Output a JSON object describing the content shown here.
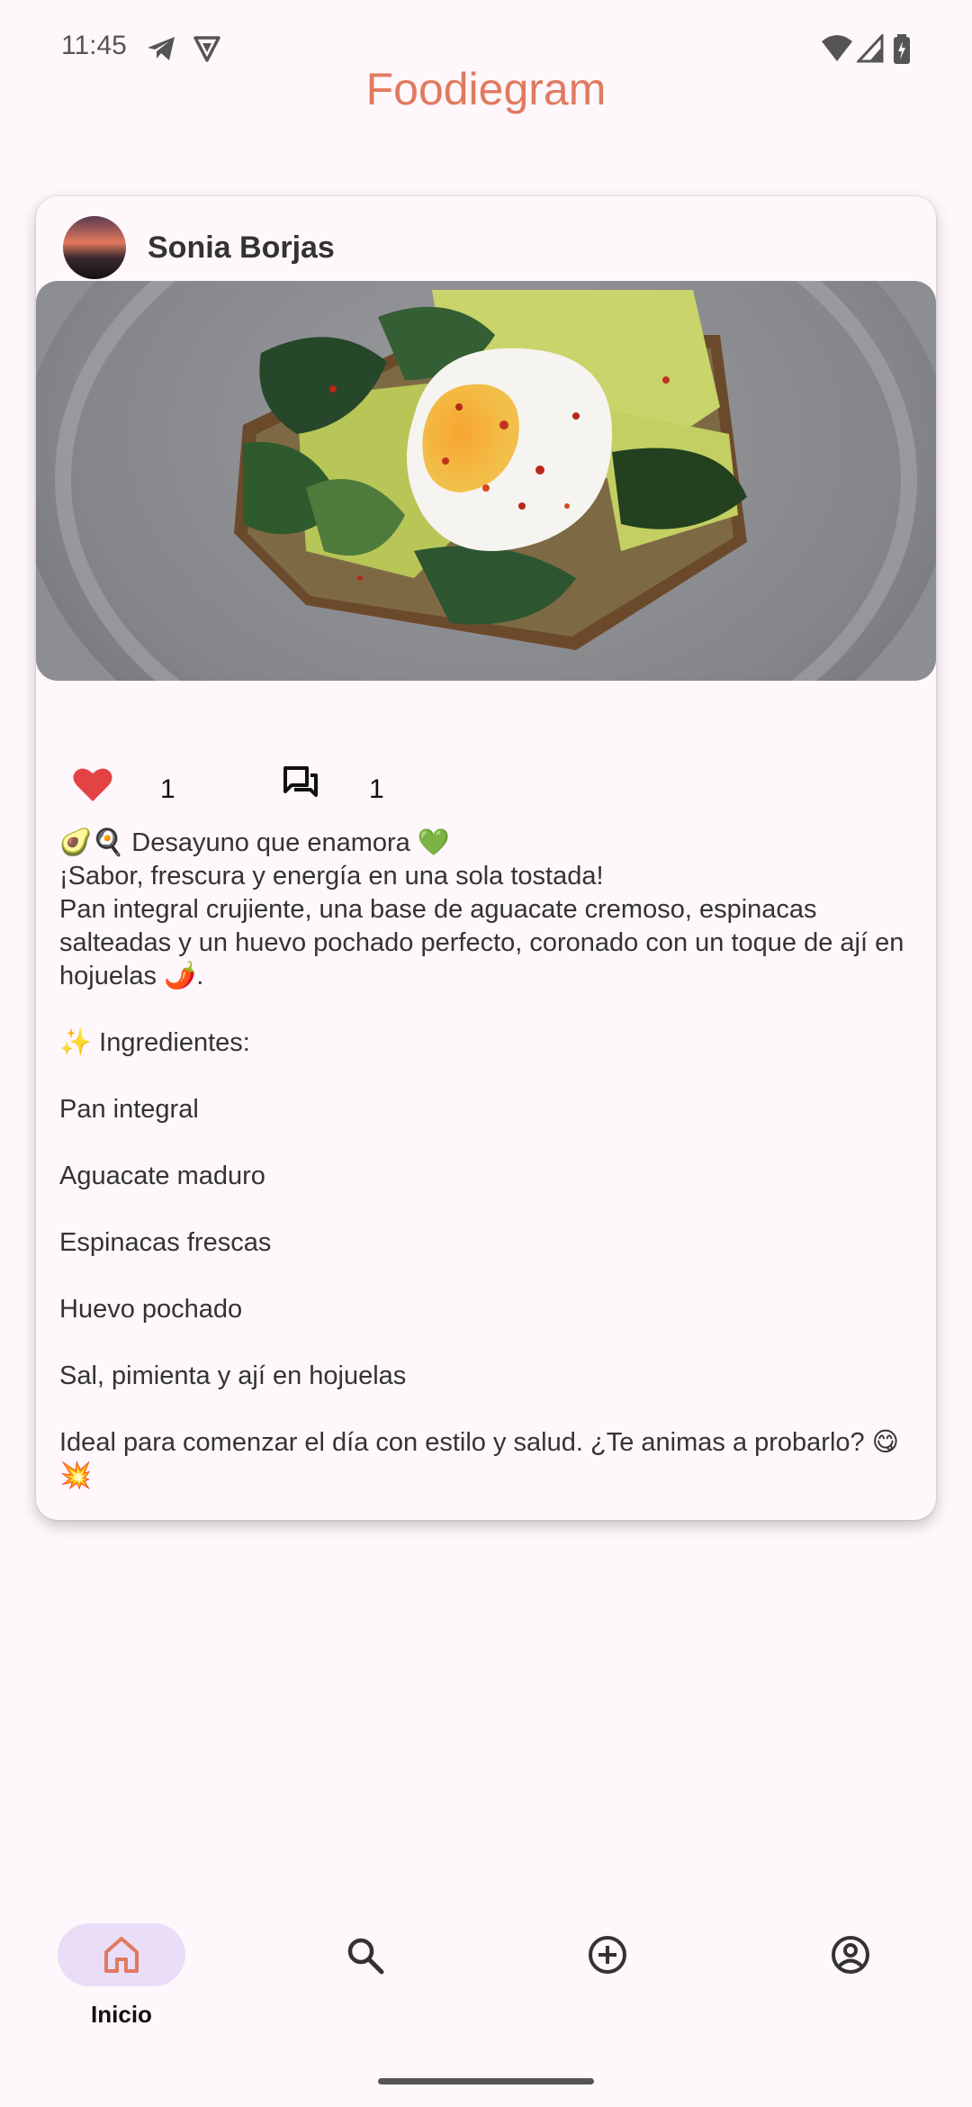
{
  "status_bar": {
    "time": "11:45",
    "icons": [
      "telegram-icon",
      "shield-icon",
      "wifi-icon",
      "signal-icon",
      "battery-icon"
    ]
  },
  "app": {
    "title": "Foodiegram",
    "accent_color": "#E07A5F",
    "background_color": "#FEF7FB"
  },
  "post": {
    "author": "Sonia Borjas",
    "image_description_icon": "photo",
    "likes": "1",
    "comments": "1",
    "like_color": "#E34343",
    "caption": {
      "line1": "🥑🍳 Desayuno que enamora 💚",
      "line2": "¡Sabor, frescura y energía en una sola tostada!",
      "line3": "Pan integral crujiente, una base de aguacate cremoso, espinacas salteadas y un huevo pochado perfecto, coronado con un toque de ají en hojuelas 🌶️.",
      "ingredients_title": "✨ Ingredientes:",
      "ingredients": [
        "Pan integral",
        "Aguacate maduro",
        "Espinacas frescas",
        "Huevo pochado",
        "Sal, pimienta y ají en hojuelas"
      ],
      "closing": "Ideal para comenzar el día con estilo y salud. ¿Te animas a probarlo? 😋💥"
    }
  },
  "bottom_nav": {
    "items": [
      {
        "label": "Inicio",
        "icon": "home-icon",
        "active": true
      },
      {
        "label": "",
        "icon": "search-icon",
        "active": false
      },
      {
        "label": "",
        "icon": "add-circle-icon",
        "active": false
      },
      {
        "label": "",
        "icon": "account-icon",
        "active": false
      }
    ]
  }
}
